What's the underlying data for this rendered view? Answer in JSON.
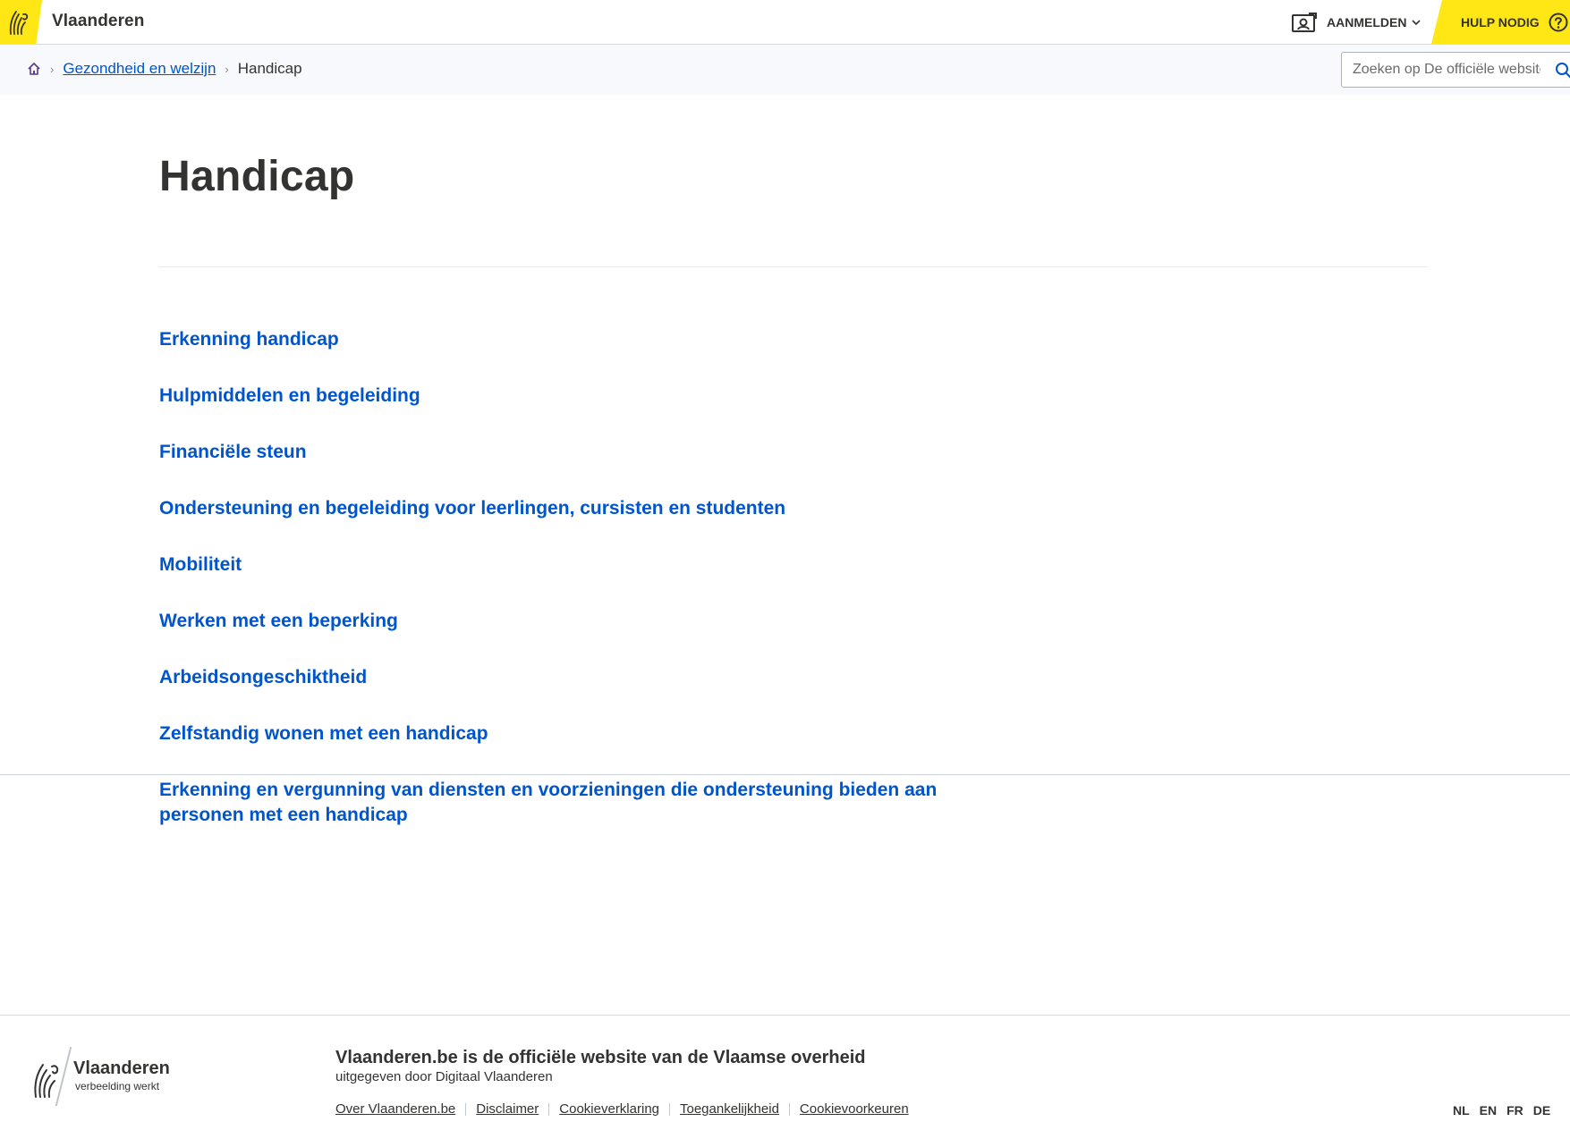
{
  "header": {
    "site_name": "Vlaanderen",
    "login_label": "AANMELDEN",
    "help_label": "HULP NODIG"
  },
  "breadcrumb": {
    "parent": "Gezondheid en welzijn",
    "current": "Handicap"
  },
  "search": {
    "placeholder": "Zoeken op De officiële website van de Vlaamse overheid"
  },
  "main": {
    "title": "Handicap",
    "links": [
      "Erkenning handicap",
      "Hulpmiddelen en begeleiding",
      "Financiële steun",
      "Ondersteuning en begeleiding voor leerlingen, cursisten en studenten",
      "Mobiliteit",
      "Werken met een beperking",
      "Arbeidsongeschiktheid",
      "Zelfstandig wonen met een handicap",
      "Erkenning en vergunning van diensten en voorzieningen die ondersteuning bieden aan personen met een handicap"
    ]
  },
  "footer": {
    "brand": "Vlaanderen",
    "tagline": "verbeelding werkt",
    "title": "Vlaanderen.be is de officiële website van de Vlaamse overheid",
    "subtitle": "uitgegeven door Digitaal Vlaanderen",
    "links": [
      "Over Vlaanderen.be",
      "Disclaimer",
      "Cookieverklaring",
      "Toegankelijkheid",
      "Cookievoorkeuren"
    ],
    "languages": [
      "NL",
      "EN",
      "FR",
      "DE"
    ]
  },
  "colors": {
    "brand_yellow": "#ffe615",
    "link_blue": "#0055cc",
    "text": "#333332"
  }
}
